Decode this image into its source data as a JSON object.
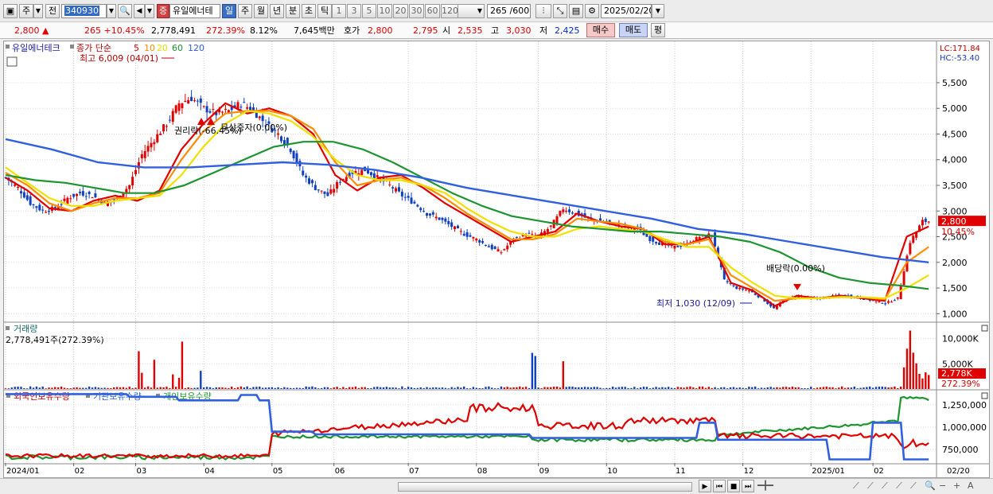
{
  "toolbar": {
    "period_prefix": "주",
    "prev_label": "전",
    "code": "340930",
    "stock_name": "유일에너테",
    "badge": "증",
    "period_tabs": [
      "일",
      "주",
      "월",
      "년",
      "분",
      "초",
      "틱"
    ],
    "active_period": "일",
    "interval_buttons": [
      "1",
      "3",
      "5",
      "10",
      "20",
      "30",
      "60",
      "120"
    ],
    "count_display": "265 /600",
    "date": "2025/02/20"
  },
  "quote": {
    "price": "2,800 ▲",
    "change": "265 +10.45%",
    "volume": "2,778,491",
    "volume_pct": "272.39%",
    "turnover_pct": "8.12%",
    "amount": "7,645백만",
    "quote_label": "호가",
    "ask": "2,800",
    "bid": "2,795",
    "open_label": "시",
    "open": "2,535",
    "high_label": "고",
    "high": "3,030",
    "low_label": "저",
    "low": "2,425",
    "buy_button": "매수",
    "sell_button": "매도",
    "eval_button": "평"
  },
  "legend": {
    "stock": "유일에너테크",
    "ma_label": "종가 단순",
    "ma_periods": [
      "5",
      "10",
      "20",
      "60",
      "120"
    ],
    "lc": "LC:171.84",
    "hc": "HC:-53.40"
  },
  "annotations": {
    "high": "최고 6,009 (04/01)",
    "low": "최저 1,030 (12/09)",
    "rights": "권리락(-66.45%)",
    "free_issue": "무상증자(0.00%)",
    "dividend": "배당락(0.00%)"
  },
  "volume_panel": {
    "title": "거래량",
    "current": "2,778,491주(272.39%)",
    "axis": [
      "10,000K",
      "5,000K"
    ],
    "tag_value": "2,778K",
    "tag_pct": "272.39%"
  },
  "holdings_panel": {
    "series_labels": [
      "외국인보유수량",
      "기관보유수량",
      "개인보유수량"
    ],
    "axis": [
      "1,250,000",
      "1,000,000",
      "750,000"
    ]
  },
  "price_tag": {
    "value": "2,800",
    "pct": "10.45%"
  },
  "x_axis_labels": [
    "2024/01",
    "02",
    "03",
    "04",
    "05",
    "06",
    "07",
    "08",
    "09",
    "10",
    "11",
    "12",
    "2025/01",
    "02",
    "02/20"
  ],
  "colors": {
    "up": "#e00000",
    "down": "#1040c0",
    "ma5": "#e00000",
    "ma10": "#ff8c00",
    "ma20": "#f0e000",
    "ma60": "#1c9430",
    "ma120": "#3060e0"
  },
  "chart_data": {
    "type": "candlestick",
    "title": "유일에너테크",
    "x_labels": [
      "2024/01",
      "02",
      "03",
      "04",
      "05",
      "06",
      "07",
      "08",
      "09",
      "10",
      "11",
      "12",
      "2025/01",
      "02"
    ],
    "y_ticks": [
      1000,
      1500,
      2000,
      2500,
      3000,
      3500,
      4000,
      4500,
      5000,
      5500
    ],
    "ylim": [
      850,
      6150
    ],
    "close_series": [
      [
        0,
        3650
      ],
      [
        4,
        3450
      ],
      [
        8,
        3150
      ],
      [
        12,
        3000
      ],
      [
        16,
        3050
      ],
      [
        20,
        3250
      ],
      [
        24,
        3350
      ],
      [
        28,
        3300
      ],
      [
        32,
        3150
      ],
      [
        36,
        3250
      ],
      [
        40,
        3500
      ],
      [
        44,
        4100
      ],
      [
        48,
        4400
      ],
      [
        52,
        4700
      ],
      [
        56,
        5100
      ],
      [
        60,
        5200
      ],
      [
        64,
        5000
      ],
      [
        68,
        4900
      ],
      [
        72,
        4950
      ],
      [
        76,
        5100
      ],
      [
        80,
        4950
      ],
      [
        84,
        4700
      ],
      [
        88,
        4500
      ],
      [
        92,
        4200
      ],
      [
        96,
        3700
      ],
      [
        100,
        3450
      ],
      [
        104,
        3300
      ],
      [
        108,
        3600
      ],
      [
        112,
        3750
      ],
      [
        116,
        3800
      ],
      [
        120,
        3650
      ],
      [
        124,
        3500
      ],
      [
        128,
        3300
      ],
      [
        132,
        3150
      ],
      [
        136,
        2950
      ],
      [
        140,
        2850
      ],
      [
        144,
        2700
      ],
      [
        148,
        2550
      ],
      [
        152,
        2450
      ],
      [
        156,
        2300
      ],
      [
        160,
        2200
      ],
      [
        164,
        2450
      ],
      [
        168,
        2550
      ],
      [
        172,
        2500
      ],
      [
        176,
        2700
      ],
      [
        180,
        3050
      ],
      [
        184,
        2950
      ],
      [
        188,
        2850
      ],
      [
        192,
        2800
      ],
      [
        196,
        2750
      ],
      [
        200,
        2700
      ],
      [
        204,
        2650
      ],
      [
        208,
        2450
      ],
      [
        212,
        2350
      ],
      [
        216,
        2300
      ],
      [
        220,
        2350
      ],
      [
        224,
        2500
      ],
      [
        228,
        2550
      ],
      [
        232,
        1650
      ],
      [
        236,
        1500
      ],
      [
        240,
        1450
      ],
      [
        244,
        1300
      ],
      [
        248,
        1100
      ],
      [
        252,
        1300
      ],
      [
        256,
        1350
      ],
      [
        260,
        1300
      ],
      [
        264,
        1300
      ],
      [
        268,
        1350
      ],
      [
        272,
        1350
      ],
      [
        276,
        1300
      ],
      [
        280,
        1250
      ],
      [
        284,
        1200
      ],
      [
        288,
        1300
      ],
      [
        292,
        2400
      ],
      [
        296,
        2800
      ],
      [
        298,
        2800
      ]
    ],
    "ma_series": [
      {
        "name": "5",
        "values": [
          3650,
          3400,
          3050,
          3000,
          3200,
          3300,
          3200,
          3400,
          4200,
          4700,
          5100,
          4900,
          5000,
          4850,
          4500,
          3700,
          3400,
          3650,
          3700,
          3450,
          3150,
          2900,
          2650,
          2400,
          2500,
          2600,
          2950,
          2800,
          2700,
          2650,
          2350,
          2350,
          2500,
          1600,
          1450,
          1150,
          1350,
          1300,
          1350,
          1300,
          1250,
          2500,
          2700
        ]
      },
      {
        "name": "10",
        "values": [
          3750,
          3500,
          3150,
          3000,
          3150,
          3250,
          3250,
          3350,
          4000,
          4550,
          4900,
          4950,
          4950,
          4850,
          4600,
          3950,
          3500,
          3600,
          3650,
          3500,
          3250,
          2950,
          2700,
          2450,
          2450,
          2550,
          2850,
          2800,
          2750,
          2650,
          2400,
          2350,
          2450,
          1750,
          1500,
          1250,
          1300,
          1300,
          1330,
          1320,
          1280,
          2000,
          2300
        ]
      },
      {
        "name": "20",
        "values": [
          3850,
          3550,
          3250,
          3100,
          3100,
          3200,
          3250,
          3300,
          3700,
          4250,
          4700,
          4950,
          4900,
          4750,
          4450,
          4000,
          3700,
          3600,
          3600,
          3500,
          3350,
          3050,
          2800,
          2600,
          2500,
          2500,
          2650,
          2700,
          2650,
          2600,
          2450,
          2300,
          2300,
          1900,
          1600,
          1350,
          1300,
          1300,
          1320,
          1320,
          1300,
          1500,
          1750
        ]
      },
      {
        "name": "60",
        "values": [
          3700,
          3600,
          3550,
          3450,
          3350,
          3350,
          3500,
          3750,
          4000,
          4250,
          4350,
          4350,
          4200,
          3950,
          3650,
          3350,
          3100,
          2900,
          2800,
          2700,
          2650,
          2600,
          2600,
          2550,
          2500,
          2400,
          2200,
          1900,
          1700,
          1600,
          1550,
          1480
        ]
      },
      {
        "name": "120",
        "values": [
          4400,
          4200,
          3950,
          3850,
          3850,
          3900,
          3950,
          3900,
          3800,
          3650,
          3450,
          3300,
          3150,
          3000,
          2850,
          2650,
          2550,
          2400,
          2250,
          2100,
          2000
        ]
      }
    ],
    "volume": {
      "ylim": [
        0,
        12000
      ],
      "unit": "K"
    },
    "holdings": {
      "ylim": [
        600000,
        1400000
      ]
    }
  }
}
